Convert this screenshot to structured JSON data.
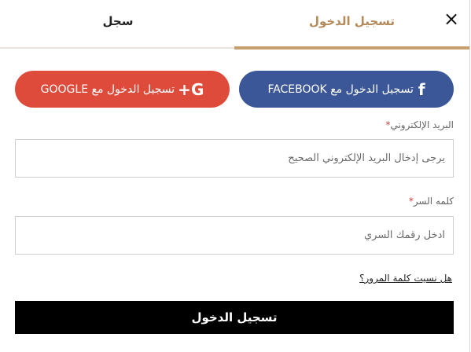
{
  "tabs": {
    "register": "سجل",
    "login": "تسجيل الدخول"
  },
  "close_icon": "×",
  "social": {
    "facebook_label": "تسجيل الدخول مع FACEBOOK",
    "facebook_icon": "f",
    "google_label": "تسجيل الدخول مع GOOGLE",
    "google_icon": "G+"
  },
  "form": {
    "email_label": "البريد الإلكتروني",
    "email_placeholder": "يرجى إدخال البريد الإلكتروني الصحيح",
    "password_label": "كلمه السر",
    "password_placeholder": "ادخل رقمك السري",
    "required_mark": "*",
    "forgot_password": "هل نسيت كلمة المرور؟",
    "submit": "تسجيل الدخول"
  },
  "colors": {
    "accent_gold": "#c79f6f",
    "facebook_blue": "#3b5798",
    "google_red": "#df4b3b",
    "submit_black": "#000000"
  }
}
